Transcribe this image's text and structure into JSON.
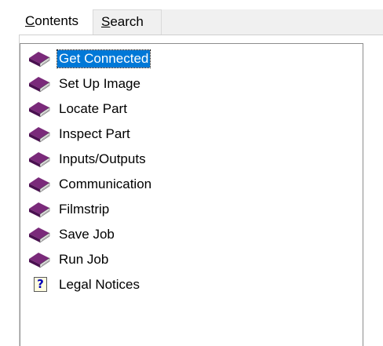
{
  "tabs": [
    {
      "label_prefix": "",
      "label_underlined": "C",
      "label_rest": "ontents",
      "active": true
    },
    {
      "label_prefix": "",
      "label_underlined": "S",
      "label_rest": "earch",
      "active": false
    }
  ],
  "tree": {
    "items": [
      {
        "label": "Get Connected",
        "icon": "book-icon",
        "selected": true
      },
      {
        "label": "Set Up Image",
        "icon": "book-icon",
        "selected": false
      },
      {
        "label": "Locate Part",
        "icon": "book-icon",
        "selected": false
      },
      {
        "label": "Inspect Part",
        "icon": "book-icon",
        "selected": false
      },
      {
        "label": "Inputs/Outputs",
        "icon": "book-icon",
        "selected": false
      },
      {
        "label": "Communication",
        "icon": "book-icon",
        "selected": false
      },
      {
        "label": "Filmstrip",
        "icon": "book-icon",
        "selected": false
      },
      {
        "label": "Save Job",
        "icon": "book-icon",
        "selected": false
      },
      {
        "label": "Run Job",
        "icon": "book-icon",
        "selected": false
      },
      {
        "label": "Legal Notices",
        "icon": "help-page-icon",
        "selected": false
      }
    ],
    "help_glyph": "?"
  },
  "colors": {
    "selection": "#0078d7",
    "book_cover": "#7a2a7a",
    "book_dark": "#4a1050",
    "book_pages": "#e8e8e8"
  }
}
